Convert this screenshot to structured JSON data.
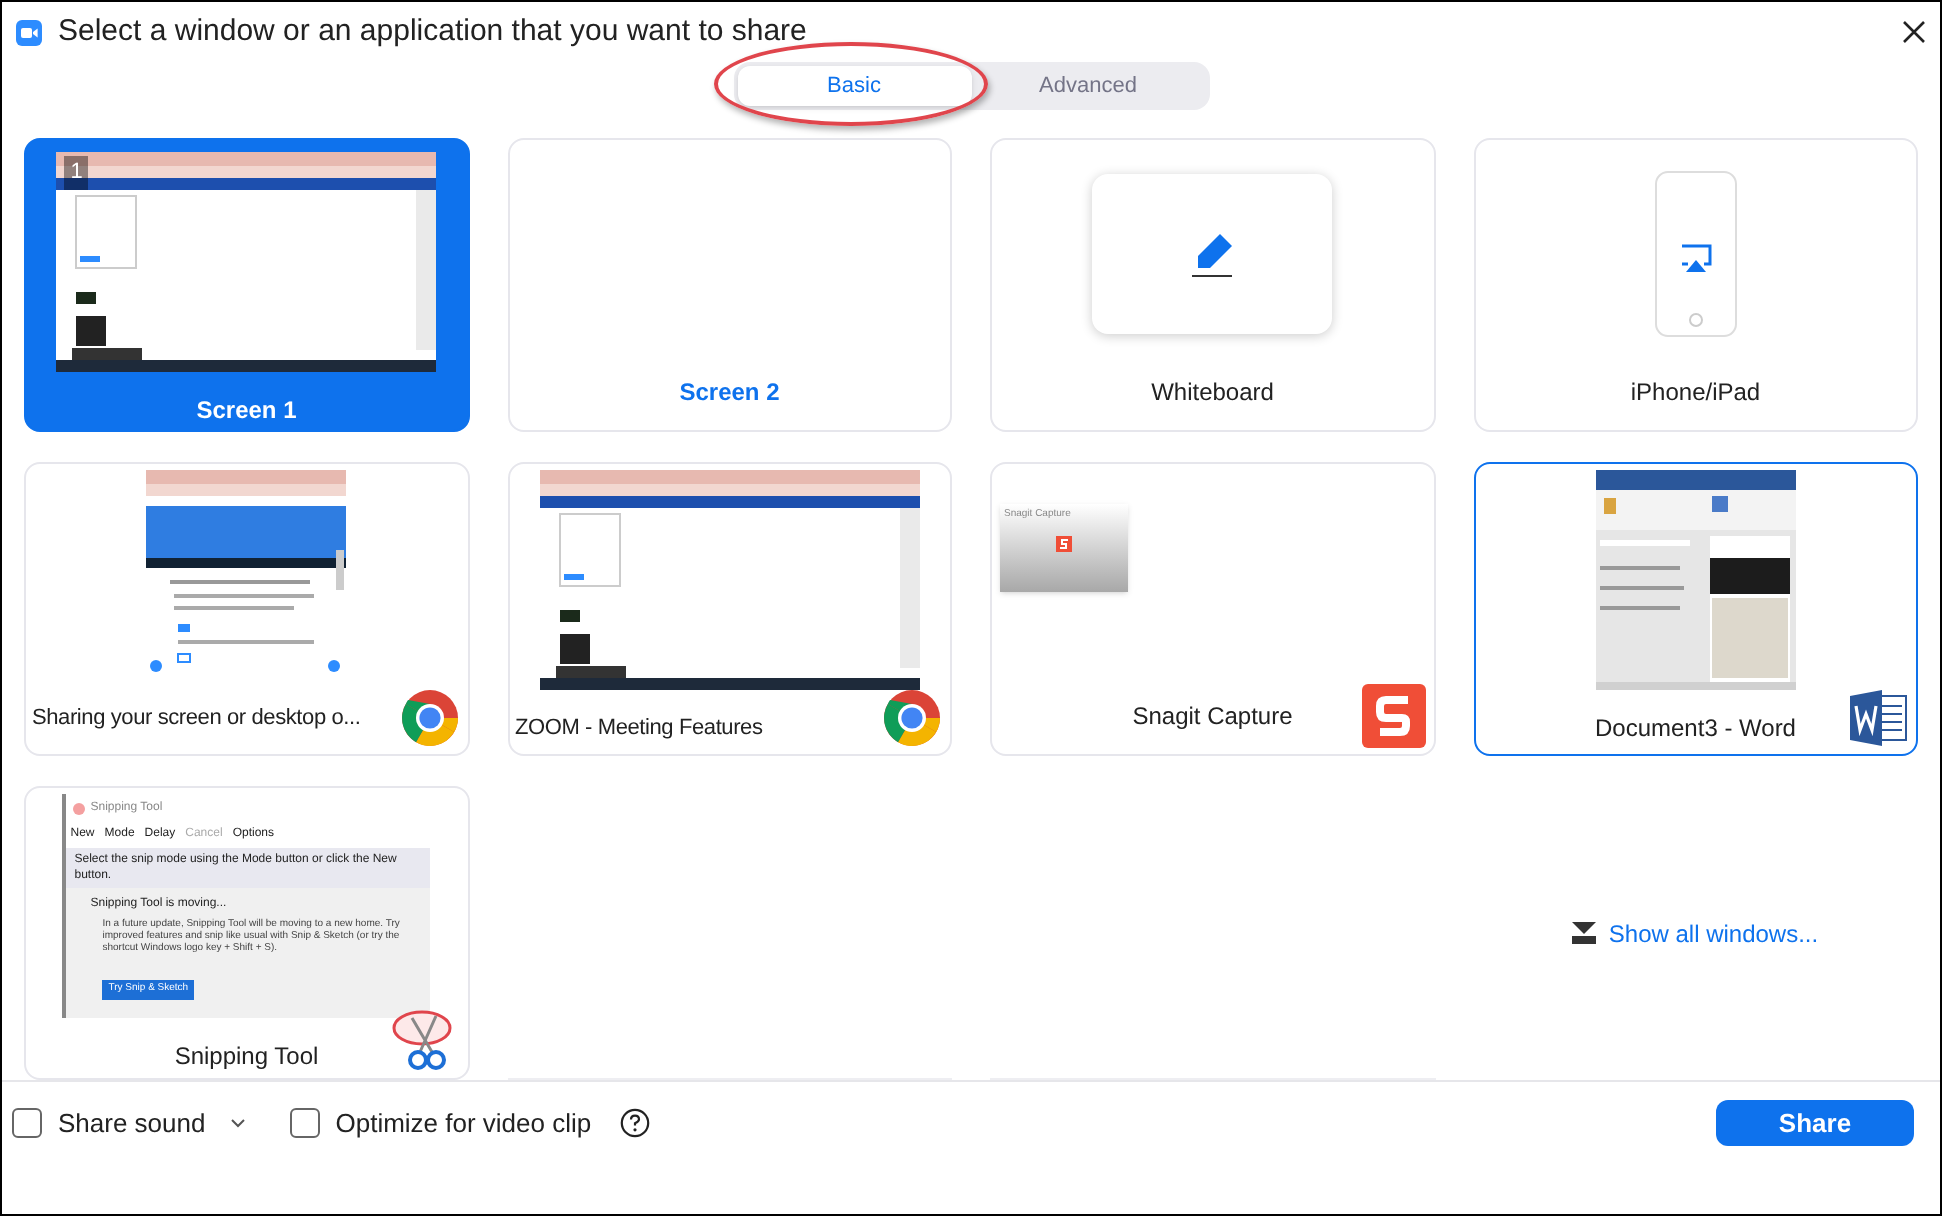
{
  "window": {
    "title": "Select a window or an application that you want to share"
  },
  "tabs": [
    {
      "label": "Basic",
      "selected": true,
      "circled": true
    },
    {
      "label": "Advanced",
      "selected": false,
      "circled": false
    }
  ],
  "sources": [
    {
      "kind": "screen",
      "label": "Screen 1",
      "selected": true,
      "focused": false,
      "badge": "1",
      "preview": {
        "kind": "browser"
      }
    },
    {
      "kind": "screen",
      "label": "Screen 2",
      "selected": false,
      "focused": false
    },
    {
      "kind": "whiteboard",
      "label": "Whiteboard",
      "selected": false,
      "focused": false
    },
    {
      "kind": "device",
      "label": "iPhone/iPad",
      "selected": false,
      "focused": false
    },
    {
      "kind": "window",
      "label": "Sharing your screen or desktop o...",
      "selected": false,
      "focused": false,
      "app": {
        "kind": "chrome"
      },
      "preview": {
        "kind": "article"
      }
    },
    {
      "kind": "window",
      "label": "ZOOM - Meeting Features",
      "selected": false,
      "focused": false,
      "app": {
        "kind": "chrome"
      },
      "preview": {
        "kind": "browser"
      }
    },
    {
      "kind": "window",
      "label": "Snagit Capture",
      "selected": false,
      "focused": false,
      "app": {
        "kind": "snagit"
      },
      "preview_title": "Snagit Capture"
    },
    {
      "kind": "window",
      "label": "Document3 - Word",
      "selected": false,
      "focused": true,
      "app": {
        "kind": "word"
      },
      "preview": {
        "kind": "word"
      }
    },
    {
      "kind": "window",
      "label": "Snipping Tool",
      "selected": false,
      "focused": false,
      "app": {
        "kind": "snipping"
      },
      "snip": {
        "title": "Snipping Tool",
        "tools": [
          "New",
          "Mode",
          "Delay",
          "Cancel",
          "Options"
        ],
        "hint": "Select the snip mode using the Mode button or click the New button.",
        "notice_title": "Snipping Tool is moving...",
        "notice": "In a future update, Snipping Tool will be moving to a new home. Try improved features and snip like usual with Snip & Sketch (or try the shortcut Windows logo key + Shift + S).",
        "notice_button": "Try Snip & Sketch"
      }
    }
  ],
  "show_all": "Show all windows...",
  "options": [
    {
      "label": "Share sound",
      "checked": false,
      "has_menu": true
    },
    {
      "label": "Optimize for video clip",
      "checked": false,
      "has_menu": false
    }
  ],
  "share_button": "Share"
}
